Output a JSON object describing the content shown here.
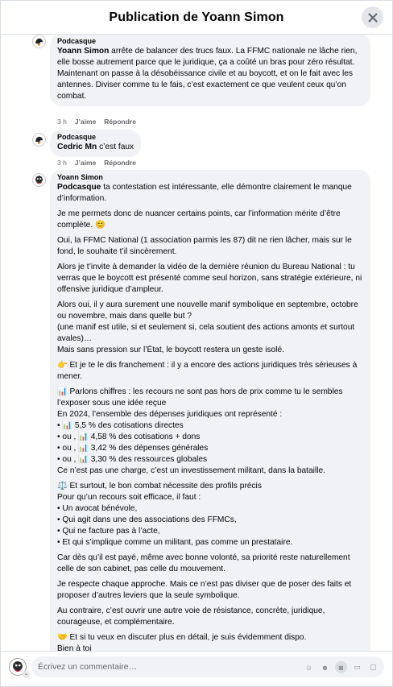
{
  "header": {
    "title": "Publication de Yoann Simon"
  },
  "comments": [
    {
      "author": "Podcasque",
      "mention": "Yoann Simon",
      "text1": " arrête de balancer des trucs faux. La FFMC nationale ne lâche rien, elle bosse autrement parce que le juridique, ça a coûté un bras pour zéro résultat.",
      "text2": "Maintenant on passe à la désobéissance civile et au boycott, et on le fait avec les antennes. Diviser comme tu le fais, c’est exactement ce que veulent ceux qu’on combat.",
      "time": "3 h",
      "like": "J’aime",
      "reply": "Répondre"
    },
    {
      "author": "Podcasque",
      "mention": "Cedric Mn",
      "text1": " c’est faux",
      "time": "3 h",
      "like": "J’aime",
      "reply": "Répondre"
    },
    {
      "author": "Yoann Simon",
      "mention": "Podcasque",
      "p1": " ta contestation est intéressante, elle démontre clairement le manque d’information.",
      "p2": "Je me permets donc de nuancer certains points, car l’information mérite d’être complète. 😊",
      "p3": "Oui, la FFMC National (1 association parmis les 87) dit ne rien lâcher, mais sur le fond, le souhaite t’il sincèrement.",
      "p4": "Alors je t’invite à demander la vidéo de la dernière réunion du Bureau National : tu verras que le boycott est présenté comme seul horizon, sans stratégie extérieure, ni offensive juridique d’ampleur.",
      "p5a": "Alors oui, il y aura surement une nouvelle manif symbolique en septembre, octobre ou novembre, mais dans quelle but ?",
      "p5b": "(une manif est utile, si et seulement si, cela soutient des actions amonts et surtout avales)…",
      "p5c": "Mais sans pression sur l’État, le boycott restera un geste isolé.",
      "p6": "👉 Et je te le dis franchement : il y a encore des actions juridiques très sérieuses à mener.",
      "p7a": "📊 Parlons chiffres : les recours ne sont pas hors de prix comme tu le sembles l’exposer sous une idée reçue",
      "p7b": "En 2024, l’ensemble des dépenses juridiques ont représenté :",
      "p7c": "• 📊 5,5 % des cotisations directes",
      "p7d": "• ou , 📊 4,58 % des cotisations + dons",
      "p7e": "• ou , 📊 3,42 % des dépenses générales",
      "p7f": "• ou , 📊 3,30 % des ressources globales",
      "p7g": "Ce n’est pas une charge, c’est un investissement militant, dans la bataille.",
      "p8a": "⚖️ Et surtout, le bon combat nécessite des profils précis",
      "p8b": "Pour qu’un recours soit efficace, il faut :",
      "p8c": "• Un avocat bénévole,",
      "p8d": "• Qui agit dans une des associations des FFMCs,",
      "p8e": "• Qui ne facture pas à l’acte,",
      "p8f": "• Et qui s’implique comme un militant, pas comme un prestataire.",
      "p9": "Car dès qu’il est payé, même avec bonne volonté, sa priorité reste naturellement celle de son cabinet, pas celle du mouvement.",
      "p10": "Je respecte chaque approche. Mais ce n’est pas diviser que de poser des faits et proposer d’autres leviers que la seule symbolique.",
      "p11": "Au contraire, c’est ouvrir une autre voie de résistance, concrète, juridique, courageuse, et complémentaire.",
      "p12a": "🤝 Et si tu veux en discuter plus en détail, je suis évidemment dispo.",
      "p12b": "Bien à toi"
    }
  ],
  "footer": {
    "placeholder": "Écrivez un commentaire…"
  }
}
